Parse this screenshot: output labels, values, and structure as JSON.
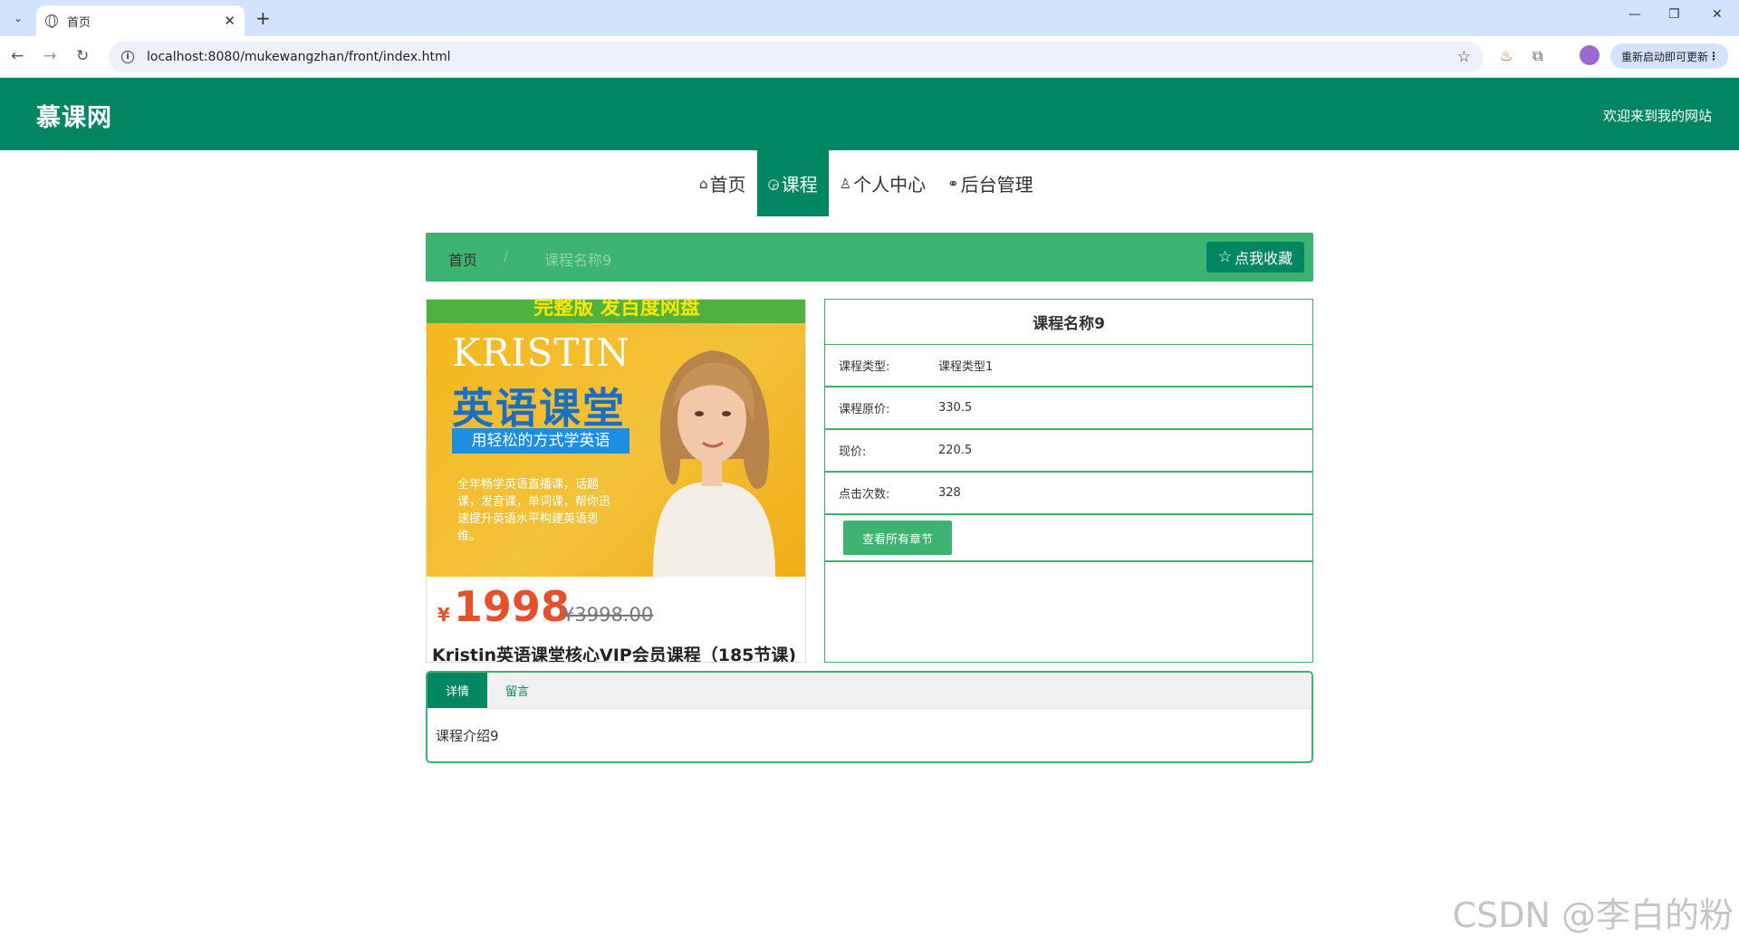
{
  "browser": {
    "tab_title": "首页",
    "url": "localhost:8080/mukewangzhan/front/index.html",
    "update_label": "重新启动即可更新"
  },
  "site": {
    "logo": "慕课网",
    "welcome": "欢迎来到我的网站"
  },
  "nav": {
    "items": [
      {
        "icon": "home-icon",
        "label": "首页"
      },
      {
        "icon": "course-icon",
        "label": "课程"
      },
      {
        "icon": "user-icon",
        "label": "个人中心"
      },
      {
        "icon": "link-icon",
        "label": "后台管理"
      }
    ],
    "active_index": 1
  },
  "breadcrumb": {
    "home": "首页",
    "separator": "/",
    "current": "课程名称9",
    "favorite_label": "点我收藏"
  },
  "poster": {
    "banner": "完整版 发百度网盘",
    "brand": "KRISTIN",
    "title_cn": "英语课堂",
    "tagline": "用轻松的方式学英语",
    "description": "全年畅学英语直播课，话题课，发音课，单词课，帮你迅速提升英语水平构建英语思维。",
    "price_symbol": "¥",
    "price": "1998",
    "old_price": "¥3998.00",
    "course_title": "Kristin英语课堂核心VIP会员课程（185节课)"
  },
  "course": {
    "name": "课程名称9",
    "fields": [
      {
        "label": "课程类型:",
        "value": "课程类型1"
      },
      {
        "label": "课程原价:",
        "value": "330.5"
      },
      {
        "label": "现价:",
        "value": "220.5"
      },
      {
        "label": "点击次数:",
        "value": "328"
      }
    ],
    "chapters_button": "查看所有章节"
  },
  "tabs": {
    "items": [
      "详情",
      "留言"
    ],
    "active_index": 0,
    "content": "课程介绍9"
  },
  "watermark": "CSDN @李白的粉",
  "colors": {
    "primary": "#008762",
    "accent": "#3cb371"
  }
}
